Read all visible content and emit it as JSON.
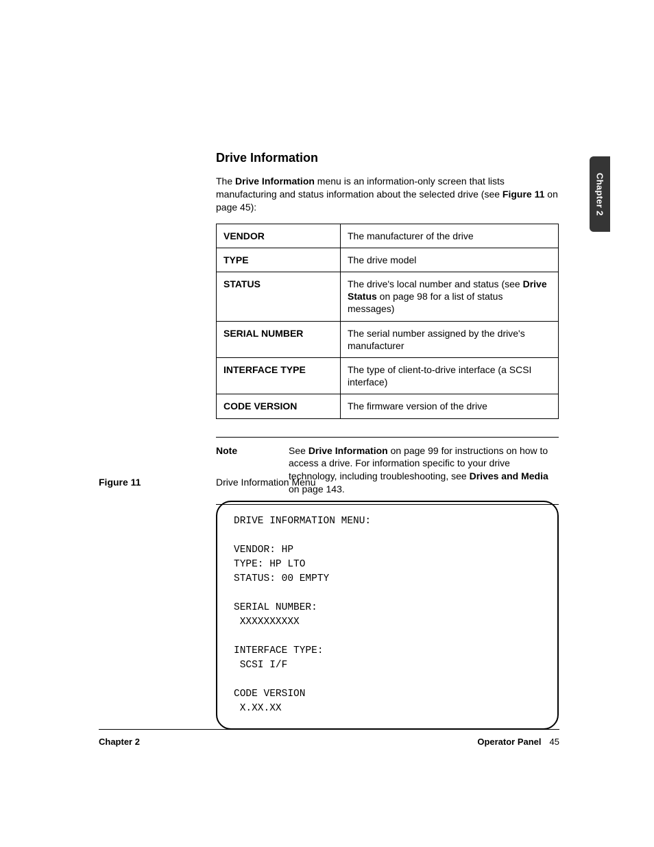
{
  "thumb_tab": "Chapter 2",
  "heading": "Drive Information",
  "intro": {
    "pre": "The ",
    "bold1": "Drive Information",
    "mid": " menu is an information-only screen that lists manufacturing and status information about the selected drive (see ",
    "bold2": "Figure 11",
    "post": " on page 45):"
  },
  "table": [
    {
      "k": "VENDOR",
      "v_pre": "The manufacturer of the drive",
      "v_bold": "",
      "v_post": ""
    },
    {
      "k": "TYPE",
      "v_pre": "The drive model",
      "v_bold": "",
      "v_post": ""
    },
    {
      "k": "STATUS",
      "v_pre": "The drive's local number and status (see ",
      "v_bold": "Drive Status",
      "v_post": " on page 98 for a list of status messages)"
    },
    {
      "k": "SERIAL NUMBER",
      "v_pre": "The serial number assigned by the drive's manufacturer",
      "v_bold": "",
      "v_post": ""
    },
    {
      "k": "INTERFACE TYPE",
      "v_pre": "The type of client-to-drive interface (a SCSI interface)",
      "v_bold": "",
      "v_post": ""
    },
    {
      "k": "CODE VERSION",
      "v_pre": "The firmware version of the drive",
      "v_bold": "",
      "v_post": ""
    }
  ],
  "note": {
    "label": "Note",
    "pre": "See ",
    "b1": "Drive Information",
    "mid1": " on page 99 for instructions on how to access a drive. For information specific to your drive technology, including troubleshooting, see ",
    "b2": "Drives and Media",
    "post": " on page 143."
  },
  "figure": {
    "label": "Figure 11",
    "caption": "Drive Information Menu"
  },
  "screen": "DRIVE INFORMATION MENU:\n\nVENDOR: HP\nTYPE: HP LTO\nSTATUS: 00 EMPTY\n\nSERIAL NUMBER:\n XXXXXXXXXX\n\nINTERFACE TYPE:\n SCSI I/F\n\nCODE VERSION\n X.XX.XX",
  "footer": {
    "left": "Chapter 2",
    "section": "Operator Panel",
    "page": "45"
  }
}
